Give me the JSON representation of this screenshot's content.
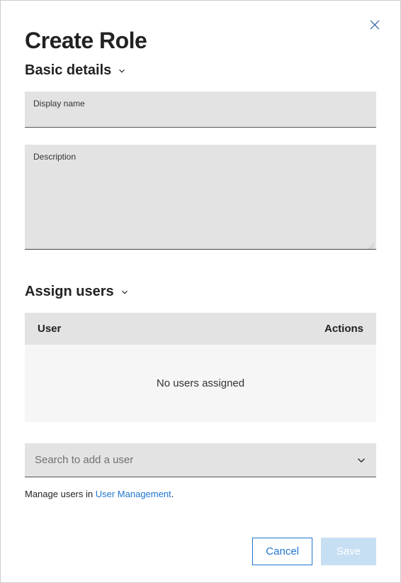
{
  "dialog": {
    "title": "Create Role",
    "sections": {
      "basic": {
        "heading": "Basic details",
        "display_name_label": "Display name",
        "display_name_value": "",
        "description_label": "Description",
        "description_value": ""
      },
      "assign": {
        "heading": "Assign users",
        "col_user": "User",
        "col_actions": "Actions",
        "empty_text": "No users assigned",
        "search_placeholder": "Search to add a user",
        "manage_prefix": "Manage users in ",
        "manage_link": "User Management",
        "manage_suffix": "."
      }
    },
    "footer": {
      "cancel": "Cancel",
      "save": "Save"
    }
  }
}
